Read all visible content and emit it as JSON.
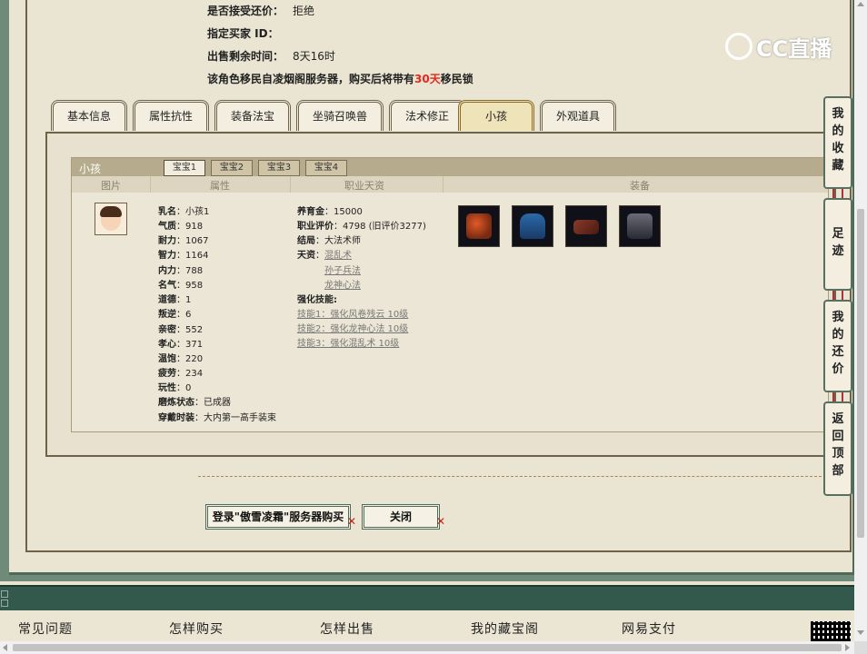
{
  "info": {
    "accept_counter_label": "是否接受还价：",
    "accept_counter_value": "拒绝",
    "buyer_id_label": "指定买家 ID：",
    "buyer_id_value": "",
    "time_left_label": "出售剩余时间：",
    "time_left_value": "8天16时",
    "migrate_pre": "该角色移民自凌烟阁服务器，购买后将带有",
    "migrate_days": "30天",
    "migrate_post": "移民锁"
  },
  "logo": {
    "text": "CC直播"
  },
  "tabs": [
    "基本信息",
    "属性抗性",
    "装备法宝",
    "坐骑召唤兽",
    "法术修正",
    "小孩",
    "外观道具"
  ],
  "active_tab": "小孩",
  "child": {
    "header": "小孩",
    "subtabs": [
      "宝宝1",
      "宝宝2",
      "宝宝3",
      "宝宝4"
    ],
    "columns": [
      "图片",
      "属性",
      "职业天资",
      "装备"
    ],
    "attributes": [
      {
        "k": "乳名",
        "v": "小孩1"
      },
      {
        "k": "气质",
        "v": "918"
      },
      {
        "k": "耐力",
        "v": "1067"
      },
      {
        "k": "智力",
        "v": "1164"
      },
      {
        "k": "内力",
        "v": "788"
      },
      {
        "k": "名气",
        "v": "958"
      },
      {
        "k": "道德",
        "v": "1"
      },
      {
        "k": "叛逆",
        "v": "6"
      },
      {
        "k": "亲密",
        "v": "552"
      },
      {
        "k": "孝心",
        "v": "371"
      },
      {
        "k": "温饱",
        "v": "220"
      },
      {
        "k": "疲劳",
        "v": "234"
      },
      {
        "k": "玩性",
        "v": "0"
      },
      {
        "k": "磨炼状态",
        "v": "已成器"
      },
      {
        "k": "穿戴时装",
        "v": "大内第一高手装束"
      }
    ],
    "career": {
      "nurture_label": "养育金",
      "nurture_value": "15000",
      "rating_label": "职业评价",
      "rating_value": "4798 (旧评价3277)",
      "ending_label": "结局",
      "ending_value": "大法术师",
      "talent_label": "天资",
      "talents": [
        "混乱术",
        "孙子兵法",
        "龙神心法"
      ],
      "skill_label": "强化技能:",
      "skills": [
        "技能1：强化风卷残云 10级",
        "技能2：强化龙神心法 10级",
        "技能3：强化混乱术 10级"
      ]
    },
    "equip_icons": [
      "gem-box-icon",
      "robe-icon",
      "scroll-icon",
      "chest-icon"
    ]
  },
  "buttons": {
    "buy": "登录\"傲雪凌霜\"服务器购买",
    "close": "关闭"
  },
  "side": {
    "fav": [
      "我",
      "的",
      "收",
      "藏"
    ],
    "trace": [
      "足",
      "迹"
    ],
    "counter": [
      "我",
      "的",
      "还",
      "价"
    ],
    "top": [
      "返",
      "回",
      "顶",
      "部"
    ]
  },
  "footer": [
    "常见问题",
    "怎样购买",
    "怎样出售",
    "我的藏宝阁",
    "网易支付"
  ],
  "colors": {
    "accent_red": "#e5261c",
    "frame_green": "#6f8a78",
    "paper": "#eae4d2"
  }
}
